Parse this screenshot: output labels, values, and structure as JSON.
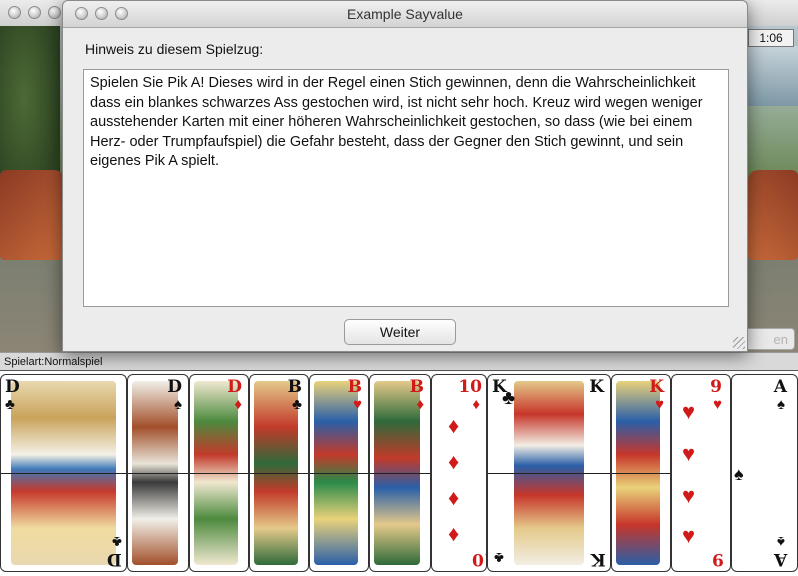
{
  "dialog": {
    "title": "Example Sayvalue",
    "heading": "Hinweis zu diesem Spielzug:",
    "hint_text": "Spielen Sie Pik A! Dieses wird in der Regel einen Stich gewinnen, denn die Wahrscheinlichkeit dass ein blankes schwarzes Ass gestochen wird, ist nicht sehr hoch. Kreuz wird wegen weniger ausstehender Karten mit einer höheren Wahrscheinlichkeit gestochen, so dass (wie bei einem Herz- oder Trumpfaufspiel) die Gefahr besteht, dass der Gegner den Stich gewinnt, und sein eigenes Pik A spielt.",
    "continue_button": "Weiter"
  },
  "game": {
    "timer": "1:06",
    "status": "Spielart:Normalspiel",
    "side_button": "en"
  },
  "cards": [
    {
      "rank": "D",
      "suit": "♣",
      "color": "black",
      "label": "Dame Kreuz"
    },
    {
      "rank": "D",
      "suit": "♠",
      "color": "black",
      "label": "Dame Pik"
    },
    {
      "rank": "D",
      "suit": "♦",
      "color": "red",
      "label": "Dame Karo"
    },
    {
      "rank": "B",
      "suit": "♣",
      "color": "black",
      "label": "Bube Kreuz"
    },
    {
      "rank": "B",
      "suit": "♥",
      "color": "red",
      "label": "Bube Herz"
    },
    {
      "rank": "B",
      "suit": "♦",
      "color": "red",
      "label": "Bube Karo"
    },
    {
      "rank": "10",
      "suit": "♦",
      "color": "red",
      "label": "Zehn Karo"
    },
    {
      "rank": "K",
      "suit": "♣",
      "color": "black",
      "label": "König Kreuz"
    },
    {
      "rank": "K",
      "suit": "♥",
      "color": "red",
      "label": "König Herz"
    },
    {
      "rank": "9",
      "suit": "♥",
      "color": "red",
      "label": "Neun Herz"
    },
    {
      "rank": "A",
      "suit": "♠",
      "color": "black",
      "label": "Ass Pik"
    }
  ],
  "colors": {
    "red_suit": "#d11a1a",
    "black_suit": "#111111"
  }
}
